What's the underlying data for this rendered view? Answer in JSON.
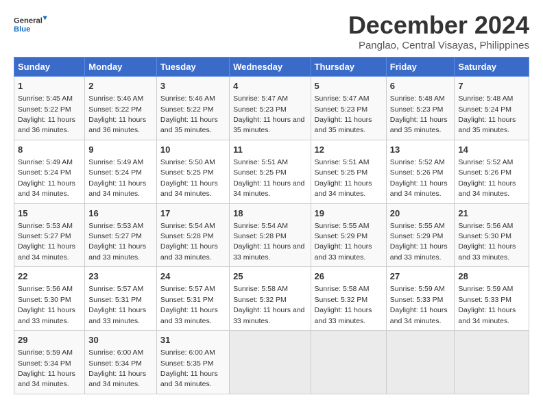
{
  "logo": {
    "line1": "General",
    "line2": "Blue"
  },
  "title": "December 2024",
  "subtitle": "Panglao, Central Visayas, Philippines",
  "days_of_week": [
    "Sunday",
    "Monday",
    "Tuesday",
    "Wednesday",
    "Thursday",
    "Friday",
    "Saturday"
  ],
  "weeks": [
    [
      {
        "day": "1",
        "sunrise": "5:45 AM",
        "sunset": "5:22 PM",
        "daylight": "11 hours and 36 minutes."
      },
      {
        "day": "2",
        "sunrise": "5:46 AM",
        "sunset": "5:22 PM",
        "daylight": "11 hours and 36 minutes."
      },
      {
        "day": "3",
        "sunrise": "5:46 AM",
        "sunset": "5:22 PM",
        "daylight": "11 hours and 35 minutes."
      },
      {
        "day": "4",
        "sunrise": "5:47 AM",
        "sunset": "5:23 PM",
        "daylight": "11 hours and 35 minutes."
      },
      {
        "day": "5",
        "sunrise": "5:47 AM",
        "sunset": "5:23 PM",
        "daylight": "11 hours and 35 minutes."
      },
      {
        "day": "6",
        "sunrise": "5:48 AM",
        "sunset": "5:23 PM",
        "daylight": "11 hours and 35 minutes."
      },
      {
        "day": "7",
        "sunrise": "5:48 AM",
        "sunset": "5:24 PM",
        "daylight": "11 hours and 35 minutes."
      }
    ],
    [
      {
        "day": "8",
        "sunrise": "5:49 AM",
        "sunset": "5:24 PM",
        "daylight": "11 hours and 34 minutes."
      },
      {
        "day": "9",
        "sunrise": "5:49 AM",
        "sunset": "5:24 PM",
        "daylight": "11 hours and 34 minutes."
      },
      {
        "day": "10",
        "sunrise": "5:50 AM",
        "sunset": "5:25 PM",
        "daylight": "11 hours and 34 minutes."
      },
      {
        "day": "11",
        "sunrise": "5:51 AM",
        "sunset": "5:25 PM",
        "daylight": "11 hours and 34 minutes."
      },
      {
        "day": "12",
        "sunrise": "5:51 AM",
        "sunset": "5:25 PM",
        "daylight": "11 hours and 34 minutes."
      },
      {
        "day": "13",
        "sunrise": "5:52 AM",
        "sunset": "5:26 PM",
        "daylight": "11 hours and 34 minutes."
      },
      {
        "day": "14",
        "sunrise": "5:52 AM",
        "sunset": "5:26 PM",
        "daylight": "11 hours and 34 minutes."
      }
    ],
    [
      {
        "day": "15",
        "sunrise": "5:53 AM",
        "sunset": "5:27 PM",
        "daylight": "11 hours and 34 minutes."
      },
      {
        "day": "16",
        "sunrise": "5:53 AM",
        "sunset": "5:27 PM",
        "daylight": "11 hours and 33 minutes."
      },
      {
        "day": "17",
        "sunrise": "5:54 AM",
        "sunset": "5:28 PM",
        "daylight": "11 hours and 33 minutes."
      },
      {
        "day": "18",
        "sunrise": "5:54 AM",
        "sunset": "5:28 PM",
        "daylight": "11 hours and 33 minutes."
      },
      {
        "day": "19",
        "sunrise": "5:55 AM",
        "sunset": "5:29 PM",
        "daylight": "11 hours and 33 minutes."
      },
      {
        "day": "20",
        "sunrise": "5:55 AM",
        "sunset": "5:29 PM",
        "daylight": "11 hours and 33 minutes."
      },
      {
        "day": "21",
        "sunrise": "5:56 AM",
        "sunset": "5:30 PM",
        "daylight": "11 hours and 33 minutes."
      }
    ],
    [
      {
        "day": "22",
        "sunrise": "5:56 AM",
        "sunset": "5:30 PM",
        "daylight": "11 hours and 33 minutes."
      },
      {
        "day": "23",
        "sunrise": "5:57 AM",
        "sunset": "5:31 PM",
        "daylight": "11 hours and 33 minutes."
      },
      {
        "day": "24",
        "sunrise": "5:57 AM",
        "sunset": "5:31 PM",
        "daylight": "11 hours and 33 minutes."
      },
      {
        "day": "25",
        "sunrise": "5:58 AM",
        "sunset": "5:32 PM",
        "daylight": "11 hours and 33 minutes."
      },
      {
        "day": "26",
        "sunrise": "5:58 AM",
        "sunset": "5:32 PM",
        "daylight": "11 hours and 33 minutes."
      },
      {
        "day": "27",
        "sunrise": "5:59 AM",
        "sunset": "5:33 PM",
        "daylight": "11 hours and 34 minutes."
      },
      {
        "day": "28",
        "sunrise": "5:59 AM",
        "sunset": "5:33 PM",
        "daylight": "11 hours and 34 minutes."
      }
    ],
    [
      {
        "day": "29",
        "sunrise": "5:59 AM",
        "sunset": "5:34 PM",
        "daylight": "11 hours and 34 minutes."
      },
      {
        "day": "30",
        "sunrise": "6:00 AM",
        "sunset": "5:34 PM",
        "daylight": "11 hours and 34 minutes."
      },
      {
        "day": "31",
        "sunrise": "6:00 AM",
        "sunset": "5:35 PM",
        "daylight": "11 hours and 34 minutes."
      },
      null,
      null,
      null,
      null
    ]
  ]
}
